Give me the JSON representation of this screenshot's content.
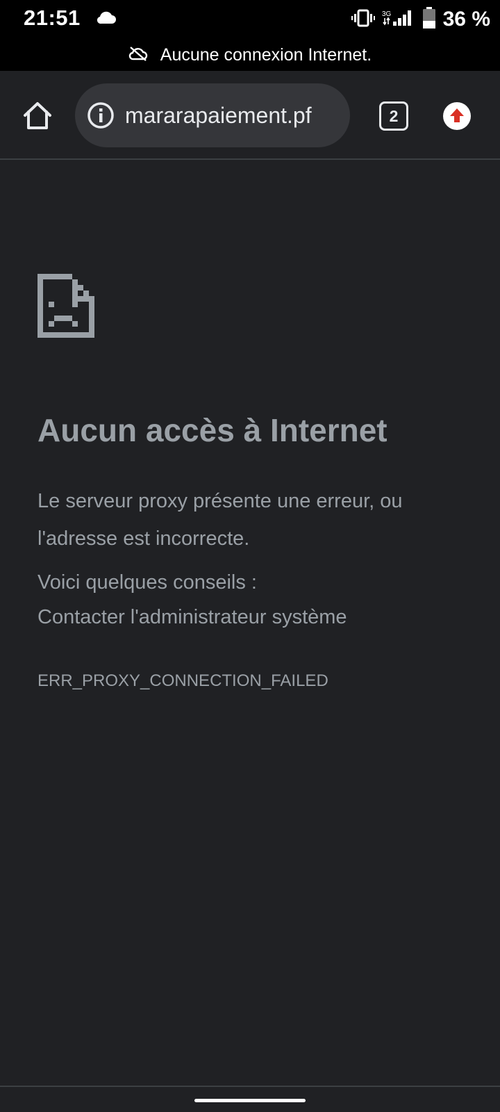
{
  "status_bar": {
    "time": "21:51",
    "battery": "36 %",
    "network": "3G"
  },
  "offline_banner": {
    "text": "Aucune connexion Internet."
  },
  "toolbar": {
    "url": "mararapaiement.pf",
    "tab_count": "2"
  },
  "error": {
    "title": "Aucun accès à Internet",
    "description": "Le serveur proxy présente une erreur, ou l'adresse est incorrecte.",
    "tips_heading": "Voici quelques conseils :",
    "tips": [
      "Contacter l'administrateur système"
    ],
    "code": "ERR_PROXY_CONNECTION_FAILED"
  },
  "colors": {
    "background": "#202124",
    "omnibox": "#35363a",
    "text_muted": "#9aa0a6",
    "update_badge": "#d93025"
  }
}
